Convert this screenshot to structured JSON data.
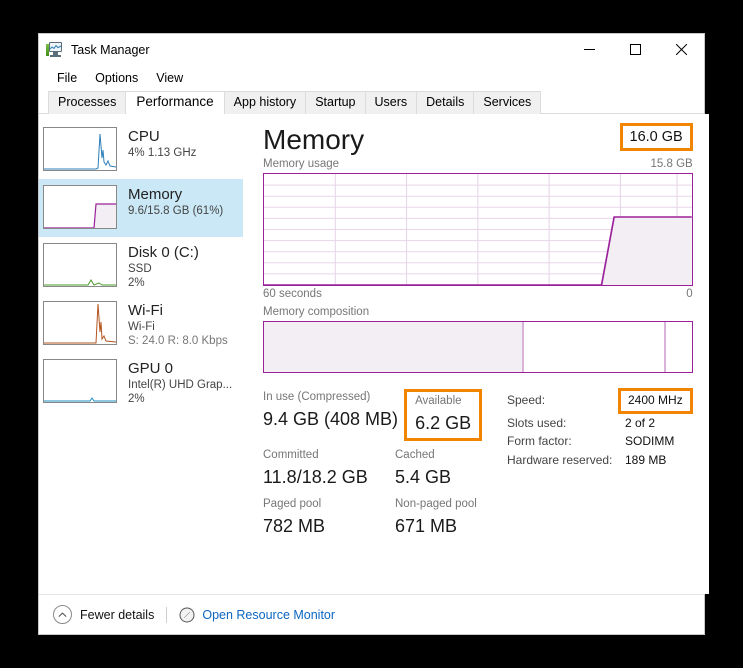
{
  "window": {
    "title": "Task Manager",
    "icon": "task-manager-icon",
    "controls": {
      "minimize": "minimize-icon",
      "maximize": "maximize-icon",
      "close": "close-icon"
    }
  },
  "menubar": {
    "items": [
      "File",
      "Options",
      "View"
    ]
  },
  "tabs": [
    {
      "label": "Processes",
      "active": false
    },
    {
      "label": "Performance",
      "active": true
    },
    {
      "label": "App history",
      "active": false
    },
    {
      "label": "Startup",
      "active": false
    },
    {
      "label": "Users",
      "active": false
    },
    {
      "label": "Details",
      "active": false
    },
    {
      "label": "Services",
      "active": false
    }
  ],
  "sidebar": {
    "items": [
      {
        "name": "CPU",
        "title": "CPU",
        "line1": "4%  1.13 GHz",
        "line2": "",
        "color": "#2d7fb8",
        "selected": false
      },
      {
        "name": "Memory",
        "title": "Memory",
        "line1": "9.6/15.8 GB (61%)",
        "line2": "",
        "color": "#9b219b",
        "selected": true
      },
      {
        "name": "Disk",
        "title": "Disk 0 (C:)",
        "line1": "SSD",
        "line2": "2%",
        "color": "#4a9b28",
        "selected": false
      },
      {
        "name": "Wi-Fi",
        "title": "Wi-Fi",
        "line1": "Wi-Fi",
        "line2": "S: 24.0 R: 8.0 Kbps",
        "color": "#b3541e",
        "selected": false
      },
      {
        "name": "GPU",
        "title": "GPU 0",
        "line1": "Intel(R) UHD Grap...",
        "line2": "2%",
        "color": "#1d8ec4",
        "selected": false
      }
    ]
  },
  "main": {
    "title": "Memory",
    "total_badge": "16.0 GB",
    "usage_label": "Memory usage",
    "usage_max": "15.8 GB",
    "axis_left": "60 seconds",
    "axis_right": "0",
    "composition_label": "Memory composition",
    "stats": {
      "in_use_label": "In use (Compressed)",
      "in_use_value": "9.4 GB (408 MB)",
      "available_label": "Available",
      "available_value": "6.2 GB",
      "committed_label": "Committed",
      "committed_value": "11.8/18.2 GB",
      "cached_label": "Cached",
      "cached_value": "5.4 GB",
      "paged_label": "Paged pool",
      "paged_value": "782 MB",
      "nonpaged_label": "Non-paged pool",
      "nonpaged_value": "671 MB"
    },
    "specs": [
      {
        "label": "Speed:",
        "value": "2400 MHz",
        "highlighted": true
      },
      {
        "label": "Slots used:",
        "value": "2 of 2",
        "highlighted": false
      },
      {
        "label": "Form factor:",
        "value": "SODIMM",
        "highlighted": false
      },
      {
        "label": "Hardware reserved:",
        "value": "189 MB",
        "highlighted": false
      }
    ]
  },
  "footer": {
    "chevron_icon": "chevron-up-icon",
    "fewer_details": "Fewer details",
    "resource_monitor_icon": "resource-monitor-icon",
    "open_resource_monitor": "Open Resource Monitor"
  },
  "colors": {
    "accent_purple": "#9b219b",
    "highlight_orange": "#f28500",
    "selection_blue": "#cbe8f6",
    "link_blue": "#0b65c2"
  },
  "chart_data": {
    "type": "area",
    "title": "Memory usage",
    "ylabel": "",
    "xlabel": "",
    "ylim": [
      0,
      15.8
    ],
    "xlim": [
      60,
      0
    ],
    "x_tick_labels": [
      "60 seconds",
      "0"
    ],
    "y_max_label": "15.8 GB",
    "grid": true,
    "grid_rows": 10,
    "grid_cols": 6,
    "series": [
      {
        "name": "In use memory",
        "x": [
          60,
          10.5,
          9.0,
          0
        ],
        "values": [
          0,
          0,
          9.6,
          9.6
        ]
      }
    ]
  },
  "composition_data": {
    "type": "bar",
    "segments": [
      {
        "name": "in-use",
        "fraction": 0.603,
        "filled": true
      },
      {
        "name": "standby",
        "fraction": 0.332,
        "filled": false
      },
      {
        "name": "free",
        "fraction": 0.065,
        "filled": false
      }
    ]
  }
}
